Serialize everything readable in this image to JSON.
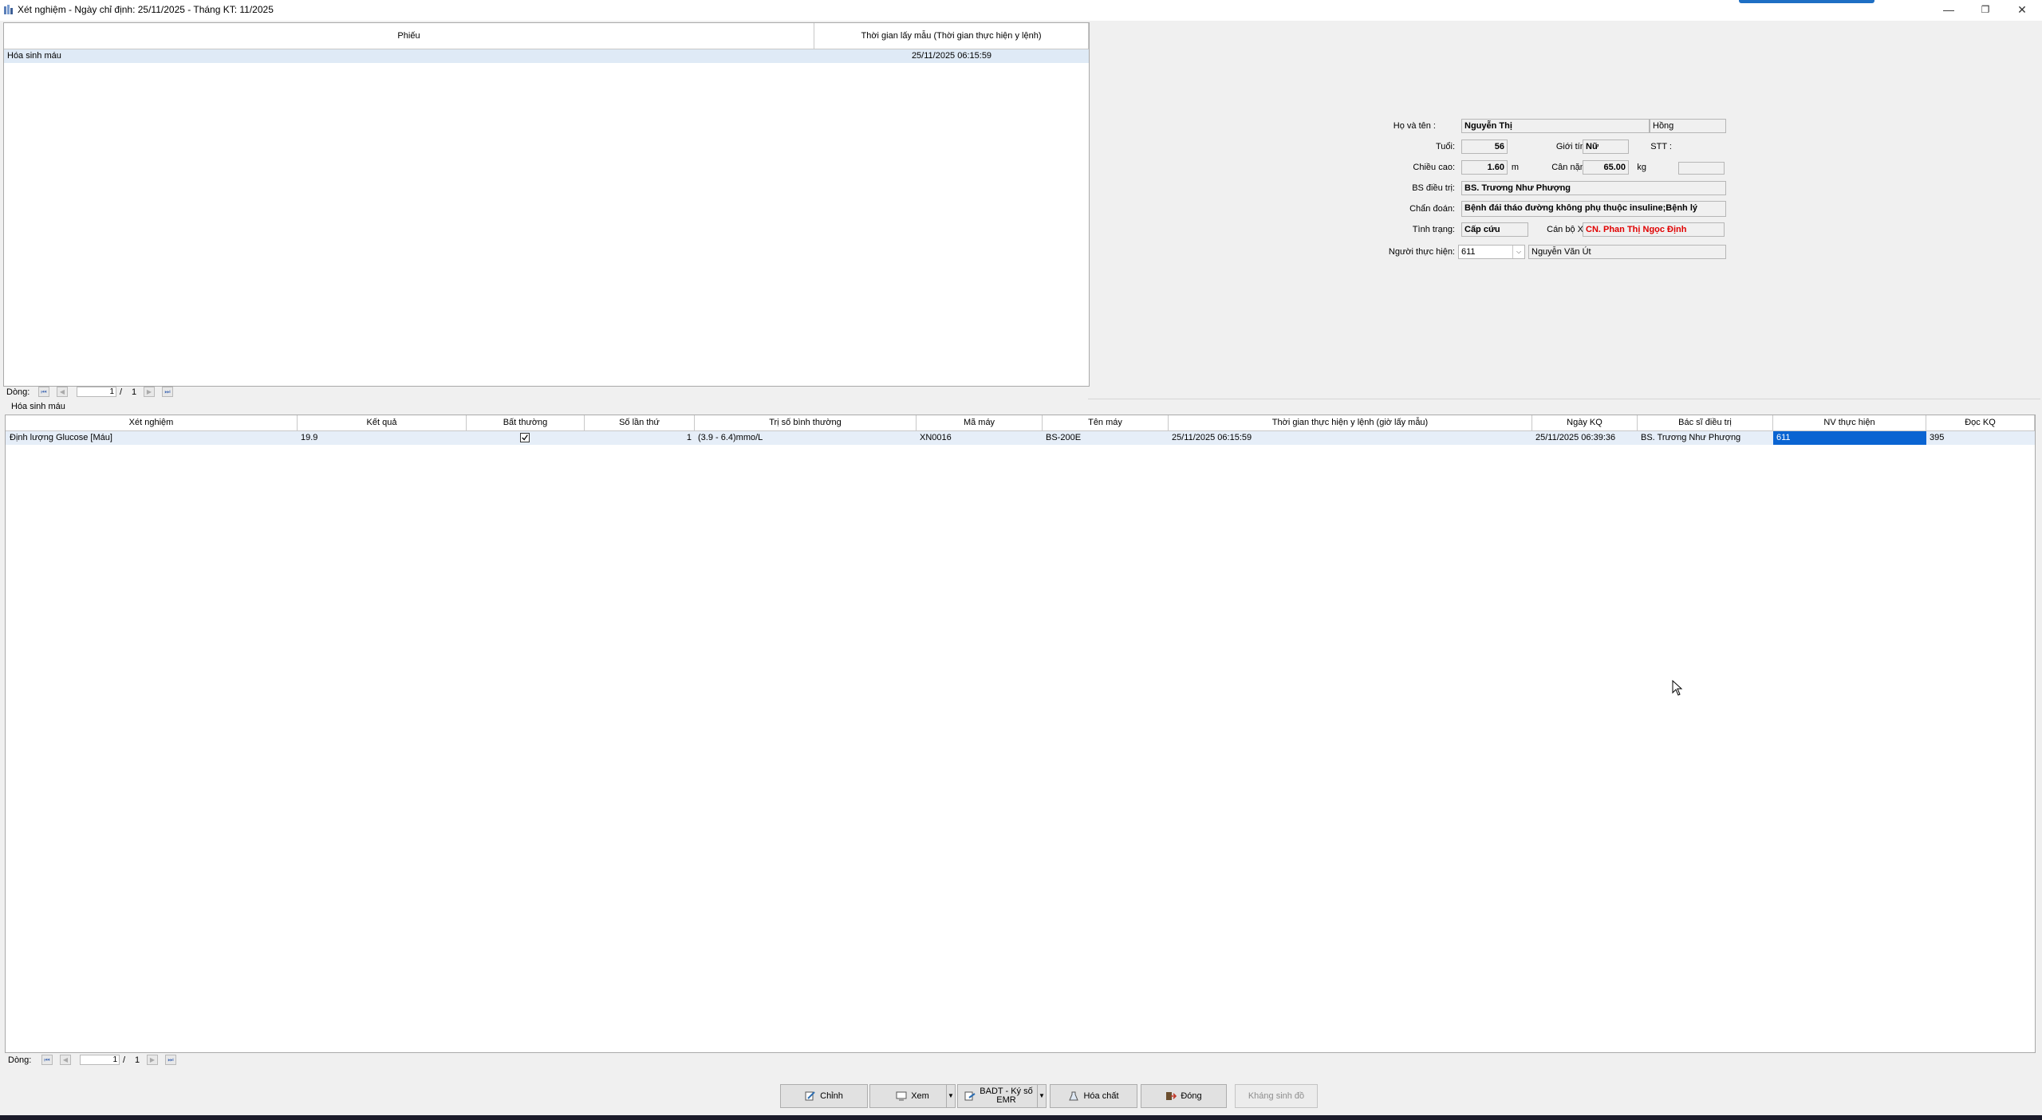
{
  "window": {
    "title": "Xét nghiệm - Ngày chỉ định: 25/11/2025 - Tháng KT: 11/2025",
    "controls": {
      "minimize": "—",
      "restore": "❐",
      "close": "✕"
    }
  },
  "slips": {
    "columns": [
      "Phiếu",
      "Thời gian lấy mẫu (Thời gian thực hiện y lệnh)"
    ],
    "rows": [
      {
        "name": "Hóa sinh máu",
        "time": "25/11/2025 06:15:59"
      }
    ],
    "pager": {
      "label": "Dòng:",
      "current": "1",
      "sep": "/",
      "total": "1"
    }
  },
  "patient": {
    "name_label": "Họ và tên :",
    "last_name": "Nguyễn Thị",
    "first_name": "Hồng",
    "age_label": "Tuổi:",
    "age": "56",
    "gender_label": "Giới tính:",
    "gender": "Nữ",
    "stt_label": "STT :",
    "stt": "",
    "height_label": "Chiều cao:",
    "height": "1.60",
    "height_unit": "m",
    "weight_label": "Cân nặng:",
    "weight": "65.00",
    "weight_unit": "kg",
    "doctor_label": "BS điều trị:",
    "doctor": "BS. Trương Như Phượng",
    "diagnosis_label": "Chẩn đoán:",
    "diagnosis": "Bệnh đái tháo đường không phụ thuộc insuline;Bệnh lý",
    "status_label": "Tình trạng:",
    "status": "Cấp cứu",
    "lab_staff_label": "Cán bộ XN:",
    "lab_staff": "CN. Phan Thị Ngọc Định",
    "performer_label": "Người thực hiện:",
    "performer_code": "611",
    "performer_name": "Nguyễn Văn Út"
  },
  "results": {
    "group_label": "Hóa sinh máu",
    "columns": [
      "Xét nghiệm",
      "Kết quả",
      "Bất thường",
      "Số lần thứ",
      "Trị số bình thường",
      "Mã máy",
      "Tên máy",
      "Thời gian thực hiện y lệnh (giờ lấy mẫu)",
      "Ngày KQ",
      "Bác sĩ điều trị",
      "NV thực hiện",
      "Đọc KQ"
    ],
    "rows": [
      {
        "test": "Định lượng Glucose [Máu]",
        "result": "19.9",
        "abnormal": true,
        "count": "1",
        "normal_range": "(3.9 - 6.4)mmo/L",
        "machine_code": "XN0016",
        "machine_name": "BS-200E",
        "order_time": "25/11/2025 06:15:59",
        "result_date": "25/11/2025 06:39:36",
        "doctor": "BS. Trương Như Phượng",
        "staff": "611",
        "reader": "395"
      }
    ],
    "pager": {
      "label": "Dòng:",
      "current": "1",
      "sep": "/",
      "total": "1"
    }
  },
  "toolbar": {
    "edit": "Chỉnh",
    "view": "Xem",
    "badt_line1": "BADT - Ký số",
    "badt_line2": "EMR",
    "chemicals": "Hóa chất",
    "close": "Đóng",
    "antibiotic": "Kháng sinh đồ"
  },
  "colors": {
    "selection": "#0a64d2",
    "row_highlight": "#dfeaf6",
    "alert_text": "#e00000"
  }
}
